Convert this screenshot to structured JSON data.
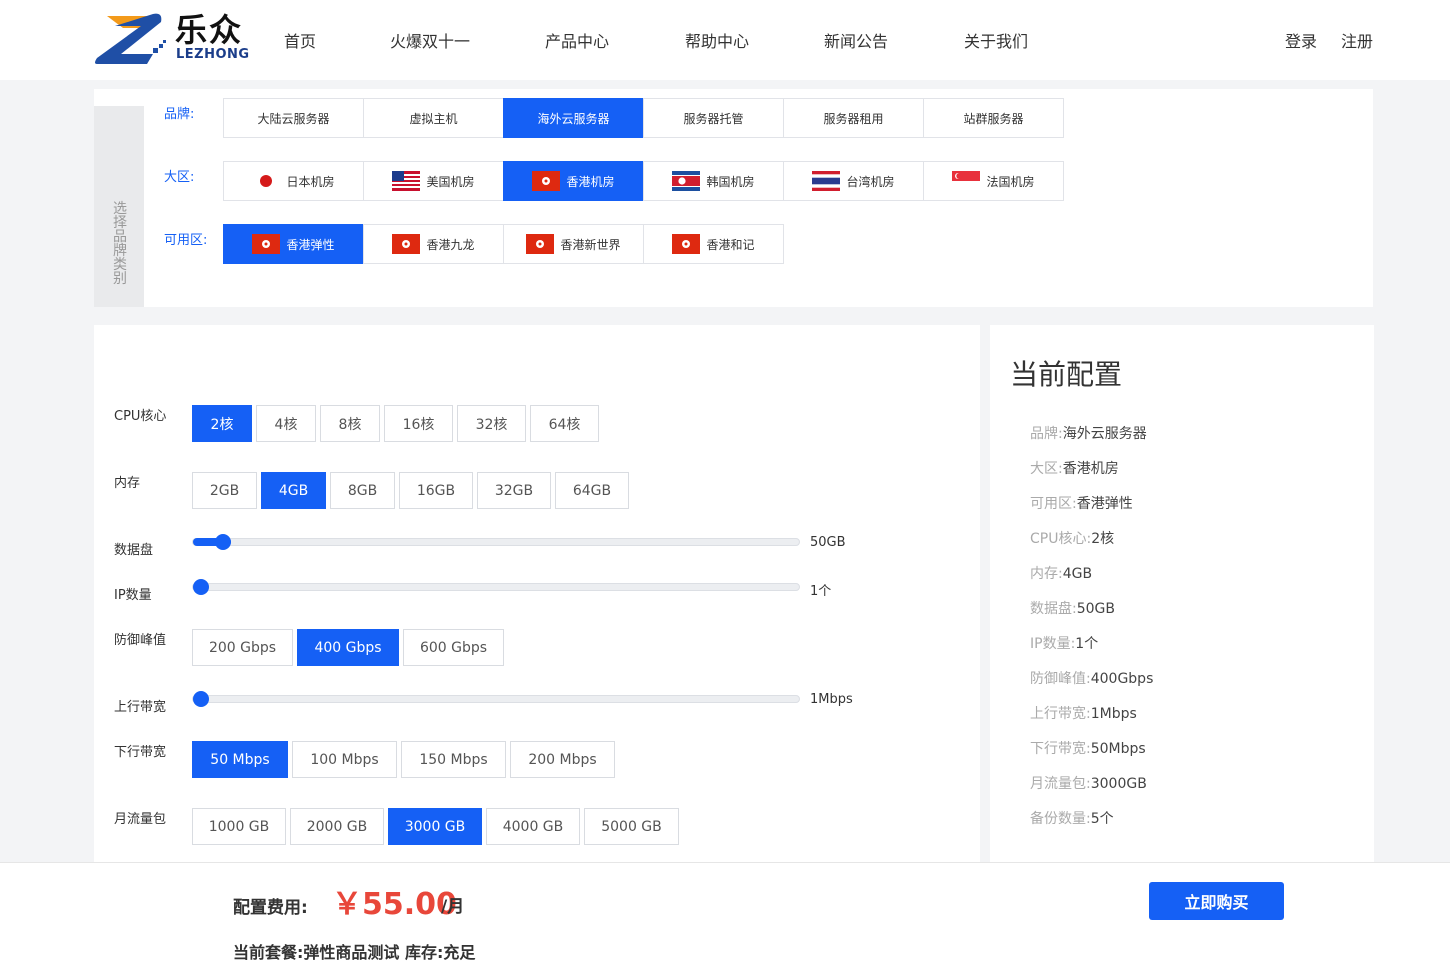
{
  "brand": {
    "name": "乐众",
    "sub": "LEZHONG"
  },
  "nav": [
    "首页",
    "火爆双十一",
    "产品中心",
    "帮助中心",
    "新闻公告",
    "关于我们"
  ],
  "auth": {
    "login": "登录",
    "register": "注册"
  },
  "category": {
    "side_label": "选择品牌类别",
    "brand_label": "品牌:",
    "brands": [
      "大陆云服务器",
      "虚拟主机",
      "海外云服务器",
      "服务器托管",
      "服务器租用",
      "站群服务器"
    ],
    "brand_active": 2,
    "region_label": "大区:",
    "regions": [
      {
        "label": "日本机房",
        "flag": "jp-flag-icon"
      },
      {
        "label": "美国机房",
        "flag": "us-flag-icon"
      },
      {
        "label": "香港机房",
        "flag": "hk-flag-icon"
      },
      {
        "label": "韩国机房",
        "flag": "kp-flag-icon"
      },
      {
        "label": "台湾机房",
        "flag": "th-flag-icon"
      },
      {
        "label": "法国机房",
        "flag": "sg-flag-icon"
      }
    ],
    "region_active": 2,
    "zone_label": "可用区:",
    "zones": [
      {
        "label": "香港弹性",
        "flag": "hk-flag-icon"
      },
      {
        "label": "香港九龙",
        "flag": "hk-flag-icon"
      },
      {
        "label": "香港新世界",
        "flag": "hk-flag-icon"
      },
      {
        "label": "香港和记",
        "flag": "hk-flag-icon"
      }
    ],
    "zone_active": 0
  },
  "config": {
    "cpu": {
      "label": "CPU核心",
      "options": [
        "2核",
        "4核",
        "8核",
        "16核",
        "32核",
        "64核"
      ],
      "active": 0
    },
    "memory": {
      "label": "内存",
      "options": [
        "2GB",
        "4GB",
        "8GB",
        "16GB",
        "32GB",
        "64GB"
      ],
      "active": 1
    },
    "disk": {
      "label": "数据盘",
      "value": "50GB",
      "fraction": 0.05
    },
    "ip": {
      "label": "IP数量",
      "value": "1个",
      "fraction": 0.0
    },
    "defense": {
      "label": "防御峰值",
      "options": [
        "200 Gbps",
        "400 Gbps",
        "600 Gbps"
      ],
      "active": 1
    },
    "upload": {
      "label": "上行带宽",
      "value": "1Mbps",
      "fraction": 0.0
    },
    "download": {
      "label": "下行带宽",
      "options": [
        "50 Mbps",
        "100 Mbps",
        "150 Mbps",
        "200 Mbps"
      ],
      "active": 0
    },
    "traffic": {
      "label": "月流量包",
      "options": [
        "1000 GB",
        "2000 GB",
        "3000 GB",
        "4000 GB",
        "5000 GB"
      ],
      "active": 2
    }
  },
  "summary": {
    "title": "当前配置",
    "rows": [
      {
        "key": "品牌:",
        "value": "海外云服务器"
      },
      {
        "key": "大区:",
        "value": "香港机房"
      },
      {
        "key": "可用区:",
        "value": "香港弹性"
      },
      {
        "key": "CPU核心:",
        "value": "2核"
      },
      {
        "key": "内存:",
        "value": "4GB"
      },
      {
        "key": "数据盘:",
        "value": "50GB"
      },
      {
        "key": "IP数量:",
        "value": "1个"
      },
      {
        "key": "防御峰值:",
        "value": "400Gbps"
      },
      {
        "key": "上行带宽:",
        "value": "1Mbps"
      },
      {
        "key": "下行带宽:",
        "value": "50Mbps"
      },
      {
        "key": "月流量包:",
        "value": "3000GB"
      },
      {
        "key": "备份数量:",
        "value": "5个"
      }
    ]
  },
  "footer": {
    "fee_label": "配置费用:",
    "fee_value": "￥55.00",
    "fee_unit": "/月",
    "package": "当前套餐:弹性商品测试 库存:充足",
    "buy": "立即购买"
  },
  "colors": {
    "accent": "#1560f5",
    "price": "#e8473a"
  }
}
